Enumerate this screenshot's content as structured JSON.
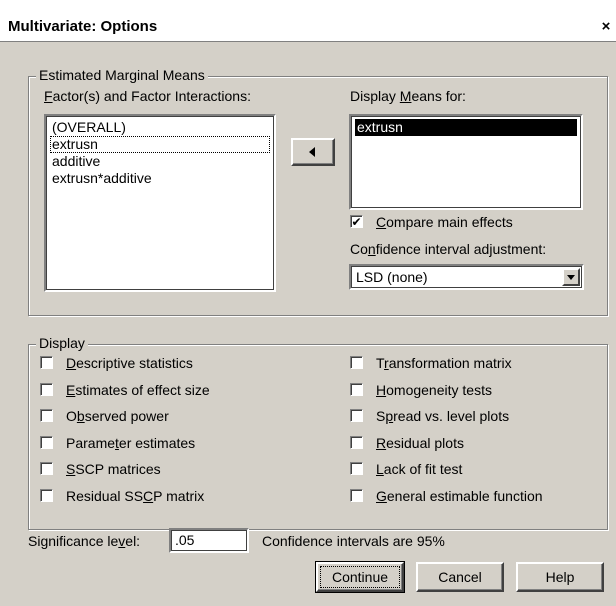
{
  "caption_fragment": "",
  "window": {
    "title": "Multivariate: Options",
    "close_label": "×"
  },
  "emm": {
    "legend": "Estimated Marginal Means",
    "factors_label": {
      "pre": "",
      "accel": "F",
      "post": "actor(s) and Factor Interactions:"
    },
    "factors_items": [
      "(OVERALL)",
      "extrusn",
      "additive",
      "extrusn*additive"
    ],
    "display_means_label": {
      "pre": "Display ",
      "accel": "M",
      "post": "eans for:"
    },
    "display_means_items": [
      "extrusn"
    ],
    "compare_main_effects": {
      "checked": true,
      "pre": "",
      "accel": "C",
      "post": "ompare main effects",
      "mark": "✔"
    },
    "ci_adjust_label": {
      "pre": "Co",
      "accel": "n",
      "post": "fidence interval adjustment:"
    },
    "ci_adjust_value": "LSD (none)"
  },
  "display": {
    "legend": "Display",
    "left": [
      {
        "pre": "",
        "accel": "D",
        "post": "escriptive statistics",
        "checked": false
      },
      {
        "pre": "",
        "accel": "E",
        "post": "stimates of effect size",
        "checked": false
      },
      {
        "pre": "O",
        "accel": "b",
        "post": "served power",
        "checked": false
      },
      {
        "pre": "Parame",
        "accel": "t",
        "post": "er estimates",
        "checked": false
      },
      {
        "pre": "",
        "accel": "S",
        "post": "SCP matrices",
        "checked": false
      },
      {
        "pre": "Residual SS",
        "accel": "C",
        "post": "P matrix",
        "checked": false
      }
    ],
    "right": [
      {
        "pre": "T",
        "accel": "r",
        "post": "ansformation matrix",
        "checked": false
      },
      {
        "pre": "",
        "accel": "H",
        "post": "omogeneity tests",
        "checked": false
      },
      {
        "pre": "S",
        "accel": "p",
        "post": "read vs. level plots",
        "checked": false
      },
      {
        "pre": "",
        "accel": "R",
        "post": "esidual plots",
        "checked": false
      },
      {
        "pre": "",
        "accel": "L",
        "post": "ack of fit test",
        "checked": false
      },
      {
        "pre": "",
        "accel": "G",
        "post": "eneral estimable function",
        "checked": false
      }
    ]
  },
  "significance": {
    "label": {
      "pre": "Significance le",
      "accel": "v",
      "post": "el:"
    },
    "value": ".05",
    "ci_text": "Confidence intervals are 95%"
  },
  "buttons": {
    "continue": "Continue",
    "cancel": "Cancel",
    "help": "Help"
  }
}
